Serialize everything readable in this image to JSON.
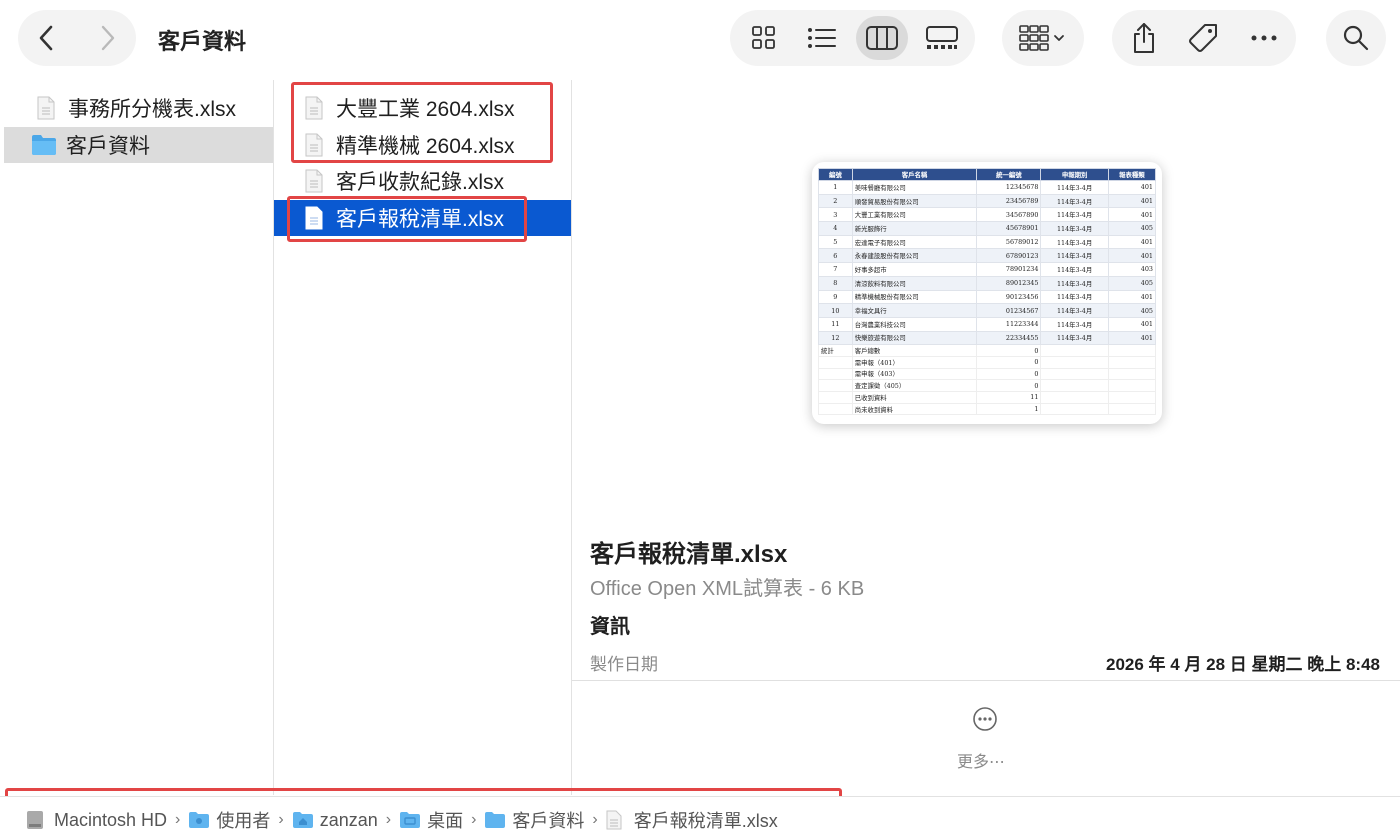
{
  "window": {
    "title": "客戶資料"
  },
  "toolbar": {
    "back_icon": "chevron-left-icon",
    "forward_icon": "chevron-right-icon",
    "views": [
      "icon-view",
      "list-view",
      "column-view",
      "gallery-view"
    ],
    "active_view": "column-view"
  },
  "sidebar": {
    "items": [
      {
        "label": "事務所分機表.xlsx",
        "icon": "spreadsheet-file-icon"
      },
      {
        "label": "客戶資料",
        "icon": "folder-icon"
      }
    ]
  },
  "files": {
    "items": [
      {
        "label": "大豐工業 2604.xlsx",
        "icon": "spreadsheet-file-icon"
      },
      {
        "label": "精準機械 2604.xlsx",
        "icon": "spreadsheet-file-icon"
      },
      {
        "label": "客戶收款紀錄.xlsx",
        "icon": "spreadsheet-file-icon"
      },
      {
        "label": "客戶報稅清單.xlsx",
        "icon": "spreadsheet-file-icon",
        "selected": true
      }
    ]
  },
  "preview": {
    "file_name": "客戶報稅清單.xlsx",
    "kind": "Office Open XML試算表 - 6 KB",
    "info_heading": "資訊",
    "created_label": "製作日期",
    "created_value": "2026 年 4 月 28 日 星期二 晚上 8:48",
    "more_label": "更多⋯",
    "sheet": {
      "headers": [
        "編號",
        "客戶名稱",
        "統一編號",
        "申報期別",
        "報表種類"
      ],
      "rows": [
        [
          "1",
          "美味餐廳有限公司",
          "12345678",
          "114年3-4月",
          "401"
        ],
        [
          "2",
          "順發貿易股份有限公司",
          "23456789",
          "114年3-4月",
          "401"
        ],
        [
          "3",
          "大豐工業有限公司",
          "34567890",
          "114年3-4月",
          "401"
        ],
        [
          "4",
          "新光服飾行",
          "45678901",
          "114年3-4月",
          "405"
        ],
        [
          "5",
          "宏達電子有限公司",
          "56789012",
          "114年3-4月",
          "401"
        ],
        [
          "6",
          "永春建設股份有限公司",
          "67890123",
          "114年3-4月",
          "401"
        ],
        [
          "7",
          "好事多超市",
          "78901234",
          "114年3-4月",
          "403"
        ],
        [
          "8",
          "清涼飲料有限公司",
          "89012345",
          "114年3-4月",
          "405"
        ],
        [
          "9",
          "精準機械股份有限公司",
          "90123456",
          "114年3-4月",
          "401"
        ],
        [
          "10",
          "幸福文具行",
          "01234567",
          "114年3-4月",
          "405"
        ],
        [
          "11",
          "台灣農業科技公司",
          "11223344",
          "114年3-4月",
          "401"
        ],
        [
          "12",
          "快樂旅遊有限公司",
          "22334455",
          "114年3-4月",
          "401"
        ]
      ],
      "summary": [
        [
          "統計",
          "客戶總數",
          "0"
        ],
        [
          "",
          "需申報（401）",
          "0"
        ],
        [
          "",
          "需申報（403）",
          "0"
        ],
        [
          "",
          "查定課徵（405）",
          "0"
        ],
        [
          "",
          "已收到資料",
          "11"
        ],
        [
          "",
          "尚未收到資料",
          "1"
        ]
      ]
    }
  },
  "pathbar": {
    "crumbs": [
      {
        "label": "Macintosh HD",
        "icon": "hard-drive-icon"
      },
      {
        "label": "使用者",
        "icon": "users-folder-icon"
      },
      {
        "label": "zanzan",
        "icon": "home-folder-icon"
      },
      {
        "label": "桌面",
        "icon": "desktop-folder-icon"
      },
      {
        "label": "客戶資料",
        "icon": "folder-icon"
      },
      {
        "label": "客戶報稅清單.xlsx",
        "icon": "spreadsheet-file-icon"
      }
    ]
  }
}
